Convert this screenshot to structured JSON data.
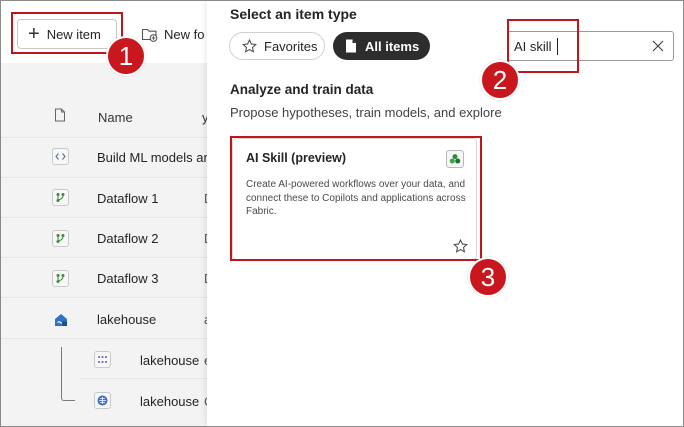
{
  "toolbar": {
    "new_item_label": "New item",
    "new_folder_label": "New fo"
  },
  "table": {
    "name_header": "Name",
    "type_header_fragment": "y",
    "rows": [
      {
        "name": "Build ML models ar",
        "type_fragment": "",
        "icon": "notebook-icon"
      },
      {
        "name": "Dataflow 1",
        "type_fragment": "D",
        "icon": "dataflow-icon"
      },
      {
        "name": "Dataflow 2",
        "type_fragment": "D",
        "icon": "dataflow-icon"
      },
      {
        "name": "Dataflow 3",
        "type_fragment": "D",
        "icon": "dataflow-icon"
      },
      {
        "name": "lakehouse",
        "type_fragment": "a",
        "icon": "lakehouse-icon"
      },
      {
        "name": "lakehouse",
        "type_fragment": "e",
        "icon": "sql-endpoint-icon"
      },
      {
        "name": "lakehouse",
        "type_fragment": "C",
        "icon": "semantic-model-icon"
      }
    ]
  },
  "panel": {
    "title": "Select an item type",
    "filters": {
      "favorites_label": "Favorites",
      "all_items_label": "All items"
    },
    "search": {
      "value": "AI skill"
    },
    "section": {
      "title": "Analyze and train data",
      "description": "Propose hypotheses, train models, and explore yo"
    },
    "card": {
      "title": "AI Skill (preview)",
      "description": "Create AI-powered workflows over your data, and connect these to Copilots and applications across Fabric."
    }
  },
  "annotations": {
    "step_1": "1",
    "step_2": "2",
    "step_3": "3",
    "color": "#c8181e"
  }
}
